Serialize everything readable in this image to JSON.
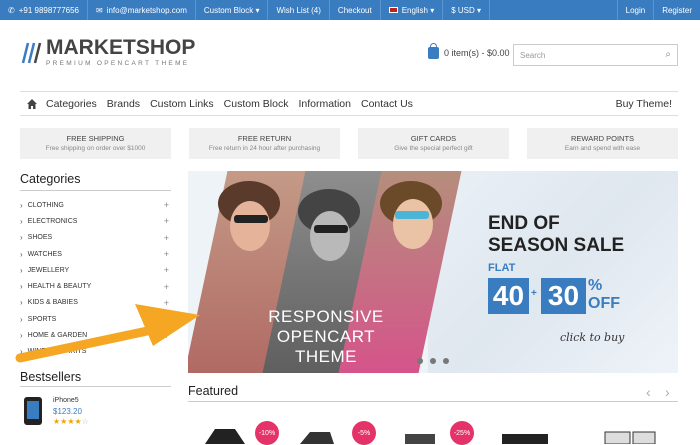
{
  "topbar": {
    "phone": "+91 9898777656",
    "email": "info@marketshop.com",
    "custom_block": "Custom Block",
    "wishlist": "Wish List (4)",
    "checkout": "Checkout",
    "language": "English",
    "currency": "$ USD",
    "login": "Login",
    "register": "Register"
  },
  "logo": {
    "title": "MARKETSHOP",
    "subtitle": "PREMIUM OPENCART THEME"
  },
  "cart": {
    "label": "0 item(s) - $0.00"
  },
  "search": {
    "placeholder": "Search"
  },
  "nav": {
    "items": [
      "Categories",
      "Brands",
      "Custom Links",
      "Custom Block",
      "Information",
      "Contact Us"
    ],
    "buy": "Buy Theme!"
  },
  "features": [
    {
      "title": "FREE SHIPPING",
      "sub": "Free shipping on order over $1000"
    },
    {
      "title": "FREE RETURN",
      "sub": "Free return in 24 hour after purchasing"
    },
    {
      "title": "GIFT CARDS",
      "sub": "Give the special perfect gift"
    },
    {
      "title": "REWARD POINTS",
      "sub": "Earn and spend with ease"
    }
  ],
  "categories": {
    "title": "Categories",
    "items": [
      {
        "label": "CLOTHING",
        "plus": "+"
      },
      {
        "label": "ELECTRONICS",
        "plus": "+"
      },
      {
        "label": "SHOES",
        "plus": "+"
      },
      {
        "label": "WATCHES",
        "plus": "+"
      },
      {
        "label": "JEWELLERY",
        "plus": "+"
      },
      {
        "label": "HEALTH & BEAUTY",
        "plus": "+"
      },
      {
        "label": "KIDS & BABIES",
        "plus": "+"
      },
      {
        "label": "SPORTS",
        "plus": ""
      },
      {
        "label": "HOME & GARDEN",
        "plus": "+"
      },
      {
        "label": "WINES & SPIRITS",
        "plus": ""
      }
    ]
  },
  "bestsellers": {
    "title": "Bestsellers",
    "product": {
      "name": "iPhone5",
      "price": "$123.20",
      "rating": 4
    }
  },
  "banner": {
    "left_line1": "RESPONSIVE",
    "left_line2": "OPENCART THEME",
    "sale_line1": "END OF",
    "sale_line2": "SEASON SALE",
    "flat": "FLAT",
    "num1": "40",
    "plus": "+",
    "num2": "30",
    "pct": "%",
    "off": "OFF",
    "click": "click to buy"
  },
  "featured": {
    "title": "Featured",
    "badges": [
      "-10%",
      "-5%",
      "-25%"
    ]
  },
  "colors": {
    "accent": "#3a7cc0",
    "badge": "#e5336a",
    "arrow": "#f5a623"
  }
}
